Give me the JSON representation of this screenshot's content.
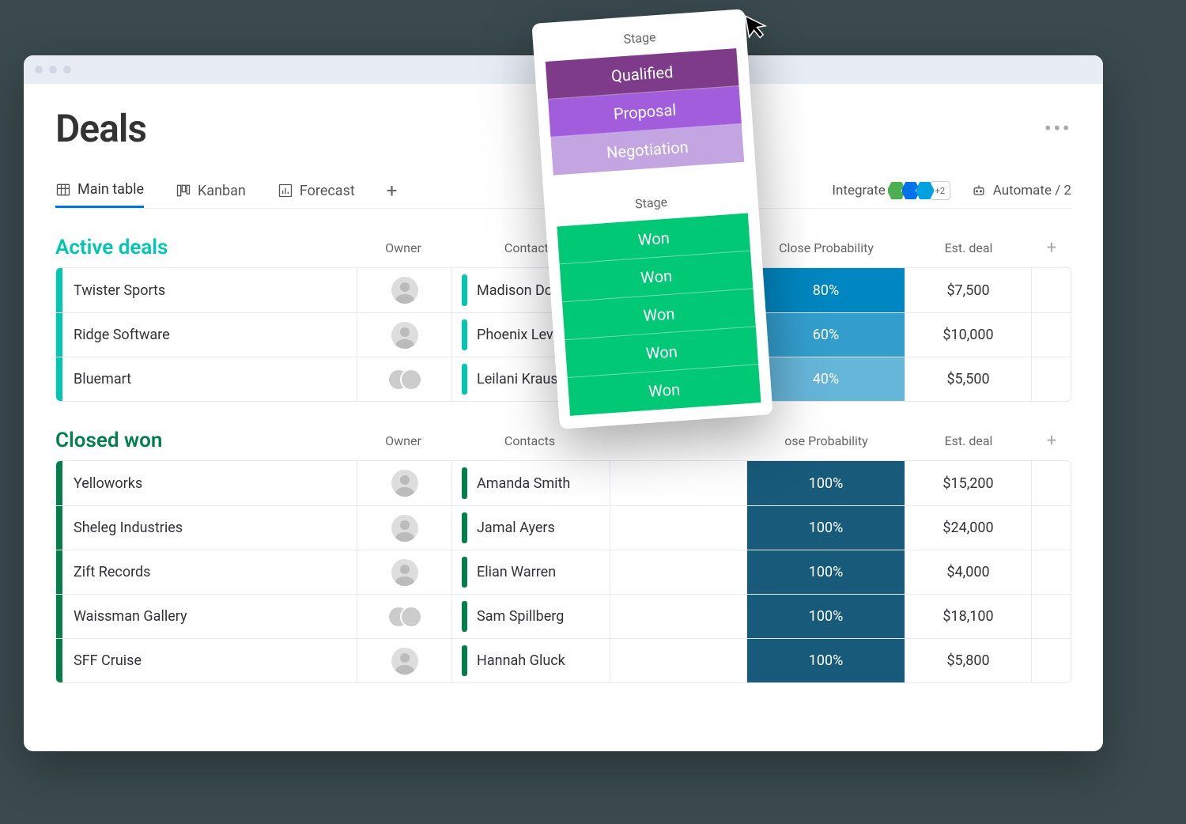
{
  "page": {
    "title": "Deals"
  },
  "tabs": {
    "main": "Main table",
    "kanban": "Kanban",
    "forecast": "Forecast"
  },
  "tools": {
    "integrate": "Integrate",
    "integrate_more": "+2",
    "automate": "Automate / 2"
  },
  "columns": {
    "owner": "Owner",
    "contacts": "Contacts",
    "prob": "Close Probability",
    "est": "Est. deal",
    "prob_short": "ose Probability"
  },
  "groups": {
    "active": {
      "title": "Active deals",
      "rows": [
        {
          "name": "Twister Sports",
          "contact": "Madison Doy",
          "prob": "80%",
          "prob_color": "#0086c0",
          "est": "$7,500",
          "owner": "single"
        },
        {
          "name": "Ridge Software",
          "contact": "Phoenix Levy",
          "prob": "60%",
          "prob_color": "#339ecd",
          "est": "$10,000",
          "owner": "single"
        },
        {
          "name": "Bluemart",
          "contact": "Leilani Krause",
          "prob": "40%",
          "prob_color": "#66b6da",
          "est": "$5,500",
          "owner": "duo"
        }
      ]
    },
    "won": {
      "title": "Closed won",
      "rows": [
        {
          "name": "Yelloworks",
          "contact": "Amanda Smith",
          "prob": "100%",
          "prob_color": "#175a7a",
          "est": "$15,200",
          "owner": "single"
        },
        {
          "name": "Sheleg Industries",
          "contact": "Jamal Ayers",
          "prob": "100%",
          "prob_color": "#175a7a",
          "est": "$24,000",
          "owner": "single"
        },
        {
          "name": "Zift Records",
          "contact": "Elian Warren",
          "prob": "100%",
          "prob_color": "#175a7a",
          "est": "$4,000",
          "owner": "single"
        },
        {
          "name": "Waissman Gallery",
          "contact": "Sam Spillberg",
          "prob": "100%",
          "prob_color": "#175a7a",
          "est": "$18,100",
          "owner": "duo"
        },
        {
          "name": "SFF Cruise",
          "contact": "Hannah Gluck",
          "prob": "100%",
          "prob_color": "#175a7a",
          "est": "$5,800",
          "owner": "single"
        }
      ]
    }
  },
  "popup": {
    "label": "Stage",
    "active_stages": [
      {
        "label": "Qualified",
        "color": "#7e3b8a"
      },
      {
        "label": "Proposal",
        "color": "#a25ddc"
      },
      {
        "label": "Negotiation",
        "color": "#c3a6e1"
      }
    ],
    "won_stages": [
      {
        "label": "Won",
        "color": "#00c875"
      },
      {
        "label": "Won",
        "color": "#00c875"
      },
      {
        "label": "Won",
        "color": "#00c875"
      },
      {
        "label": "Won",
        "color": "#00c875"
      },
      {
        "label": "Won",
        "color": "#00c875"
      }
    ]
  }
}
